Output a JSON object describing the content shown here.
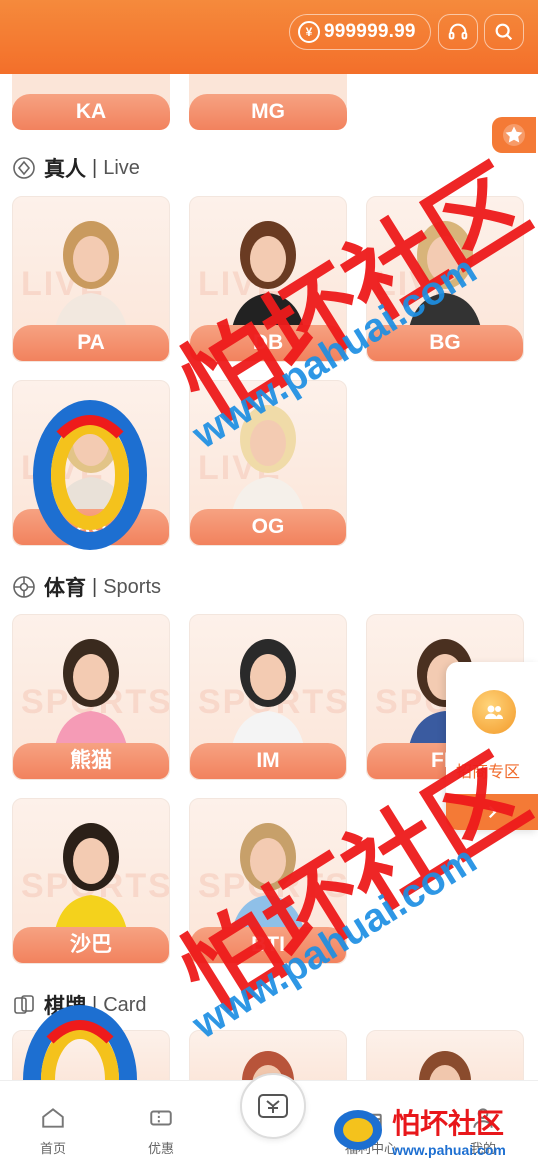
{
  "header": {
    "balance": "999999.99",
    "icons": [
      "yen-coin-icon",
      "headset-icon",
      "search-icon"
    ]
  },
  "top_row": [
    {
      "label": "KA"
    },
    {
      "label": "MG"
    }
  ],
  "sections": {
    "live": {
      "title_zh": "真人",
      "separator": "|",
      "title_en": "Live",
      "icon": "diamond-icon",
      "bg_text": "LIVE",
      "cards": [
        {
          "label": "PA"
        },
        {
          "label": "DB"
        },
        {
          "label": "BG"
        },
        {
          "label": "AG"
        },
        {
          "label": "OG"
        }
      ]
    },
    "sports": {
      "title_zh": "体育",
      "separator": "|",
      "title_en": "Sports",
      "icon": "ball-icon",
      "bg_text": "SPORTS",
      "cards": [
        {
          "label": "熊猫"
        },
        {
          "label": "IM"
        },
        {
          "label": "FB"
        },
        {
          "label": "沙巴"
        },
        {
          "label": "BTI"
        }
      ]
    },
    "cards_section": {
      "title_zh": "棋牌",
      "separator": "|",
      "title_en": "Card",
      "icon": "cards-icon"
    }
  },
  "floating": {
    "favorite_icon": "star-icon",
    "agent_label": "招商专区",
    "agent_arrow_icon": "chevron-right-icon"
  },
  "bottom_nav": {
    "items": [
      {
        "label": "首页",
        "icon": "home-icon"
      },
      {
        "label": "优惠",
        "icon": "ticket-icon"
      },
      {
        "label": "",
        "icon": "wallet-icon"
      },
      {
        "label": "福利中心",
        "icon": "gift-icon"
      },
      {
        "label": "我的",
        "icon": "user-icon"
      }
    ]
  },
  "watermark": {
    "text_cn": "怕坏社区",
    "text_url": "www.pahuai.com",
    "colors": {
      "red": "#ee1b1b",
      "blue": "#1d8fe3"
    }
  },
  "colors": {
    "accent": "#f47a36",
    "label_grad_top": "#f6a282",
    "label_grad_bottom": "#f2825e",
    "card_bg": "#fbe5d8"
  }
}
